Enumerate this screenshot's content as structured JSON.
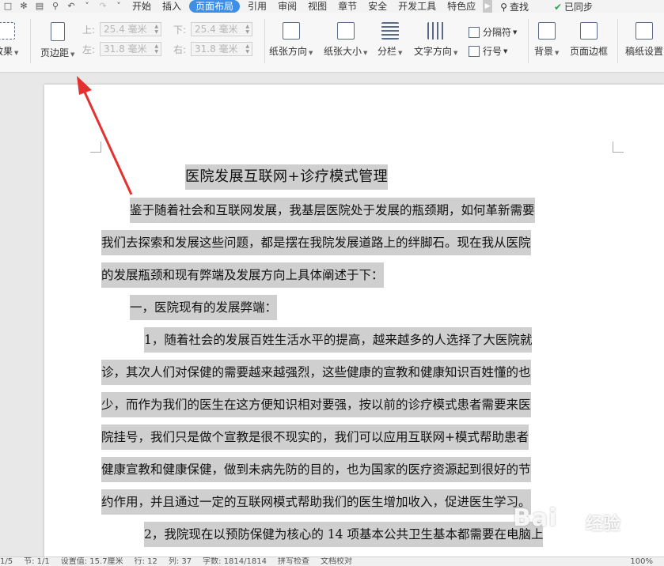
{
  "menubar": {
    "quick_icons": [
      "save-icon",
      "format-painter-icon",
      "print-icon",
      "print-preview-icon",
      "undo-icon",
      "redo-icon",
      "dropdown-icon"
    ],
    "tabs": [
      "开始",
      "插入",
      "页面布局",
      "引用",
      "审阅",
      "视图",
      "章节",
      "安全",
      "开发工具",
      "特色应"
    ],
    "active_tab": "页面布局",
    "search": "查找",
    "sync": "已同步"
  },
  "ribbon": {
    "effects": "效果",
    "margins": "页边距",
    "margin_top_label": "上:",
    "margin_top_value": "25.4 毫米",
    "margin_bottom_label": "下:",
    "margin_bottom_value": "25.4 毫米",
    "margin_left_label": "左:",
    "margin_left_value": "31.8 毫米",
    "margin_right_label": "右:",
    "margin_right_value": "31.8 毫米",
    "orientation": "纸张方向",
    "paper_size": "纸张大小",
    "columns": "分栏",
    "text_direction": "文字方向",
    "breaks": "分隔符",
    "line_numbers": "行号",
    "background": "背景",
    "page_border": "页面边框",
    "manuscript": "稿纸设置"
  },
  "document": {
    "title": "医院发展互联网+诊疗模式管理",
    "lines": [
      "鉴于随着社会和互联网发展，我基层医院处于发展的瓶颈期，如何革新需要",
      "我们去探索和发展这些问题，都是摆在我院发展道路上的绊脚石。现在我从医院",
      "的发展瓶颈和现有弊端及发展方向上具体阐述于下：",
      "一，医院现有的发展弊端：",
      "1，随着社会的发展百姓生活水平的提高，越来越多的人选择了大医院就",
      "诊，其次人们对保健的需要越来越强烈，这些健康的宣教和健康知识百姓懂的也",
      "少，而作为我们的医生在这方便知识相对要强，按以前的诊疗模式患者需要来医",
      "院挂号，我们只是做个宣教是很不现实的，我们可以应用互联网+模式帮助患者",
      "健康宣教和健康保健，做到未病先防的目的，也为国家的医疗资源起到很好的节",
      "约作用，并且通过一定的互联网模式帮助我们的医生增加收入，促进医生学习。",
      "2，我院现在以预防保健为核心的 14 项基本公共卫生基本都需要在电脑上"
    ]
  },
  "watermark": {
    "text": "Bai",
    "suffix": "经验"
  },
  "status": {
    "items": [
      "1/5",
      "节: 1/1",
      "设置值: 15.7厘米",
      "行: 12",
      "列: 37",
      "字数: 1814/1814",
      "拼写检查",
      "文档校对",
      "100%"
    ]
  },
  "annotation": {
    "color": "#e53030"
  }
}
